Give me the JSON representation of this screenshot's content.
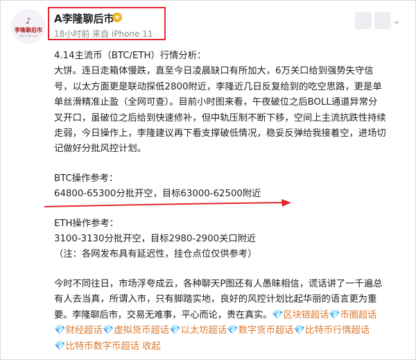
{
  "header": {
    "avatar_text": "李隆聊后市",
    "avatar_sub": "财经 行情 分析",
    "user_name": "A李隆聊后市",
    "meta": "18小时前 来自 iPhone 11"
  },
  "post": {
    "lines_top": [
      "4.14主流币（BTC/ETH）行情分析：",
      "大饼。连日走箱体慢跌，直至今日凌晨缺口有所加大，6万关口给到强势失守信",
      "号，以太方面更是联动探低2800附近，李隆近几日反复给到的吃空思路，更是单",
      "单丝滑精准止盈（全网可查）。目前小时图来看，午夜破位之后BOLL通道异常分",
      "叉开口，虽破位之后给到快速修补，但中轨压制不断下移，空间上主流抗跌性持续",
      "走弱，今日操作上，李隆建议再下看支撑破低情况，稳妥反弹给我接着空，进场切",
      "记做好分批风控计划。"
    ],
    "btc_title": "BTC操作参考：",
    "btc_plan": "64800-65300分批开空，目标63000-62500附近",
    "eth_title": "ETH操作参考：",
    "eth_plan": "3100-3130分批开空，目标2980-2900关口附近",
    "note": "（注：各网发布具有延迟性，挂仓点位仅供参考）",
    "closing_lines": [
      "今时不同往日，市场浮夸成云，各种聊天P图还有人愚昧相信，谎话讲了一千遍总",
      "有人去当真，所谓入市，只有脚踏实地，良好的风控计划比起华丽的语言更为重",
      "要。李隆聊后市，交易无难事，平心而论，贵在真实。"
    ],
    "topics": [
      "💎区块链超话",
      "💎币圈超话",
      "💎财经超话",
      "💎虚拟货币超话",
      "💎以太坊超话",
      "💎数字货币超话",
      "💎比特币行情超话",
      "💎比特币数字币超话"
    ],
    "collapse_label": "收起"
  },
  "colors": {
    "highlight_box": "#e3262f",
    "arrow": "#e3262f",
    "topic": "#e07a2e"
  }
}
